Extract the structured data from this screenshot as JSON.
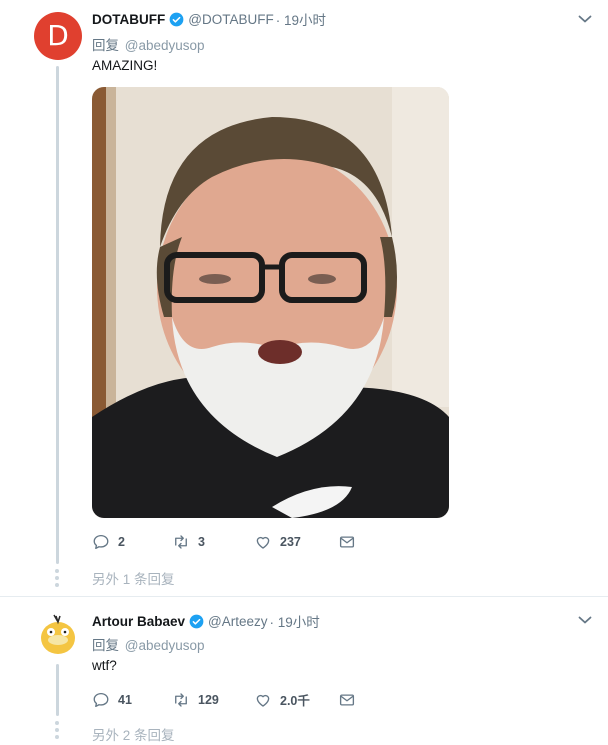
{
  "tweets": [
    {
      "avatar_letter": "D",
      "display_name": "DOTABUFF",
      "handle": "@DOTABUFF",
      "time": "· 19小时",
      "reply_prefix": "回复",
      "reply_to": "@abedyusop",
      "text": "AMAZING!",
      "media_description": "photo-of-bearded-man-with-glasses",
      "replies": "2",
      "retweets": "3",
      "likes": "237",
      "more_replies": "另外 1 条回复"
    },
    {
      "display_name": "Artour Babaev",
      "handle": "@Arteezy",
      "time": "· 19小时",
      "reply_prefix": "回复",
      "reply_to": "@abedyusop",
      "text": "wtf?",
      "replies": "41",
      "retweets": "129",
      "likes": "2.0千",
      "more_replies": "另外 2 条回复"
    }
  ],
  "colors": {
    "verified": "#1da1f2",
    "avatar_d": "#e0402f",
    "icon_gray": "#657786",
    "thread_line": "#ccd6dd"
  }
}
